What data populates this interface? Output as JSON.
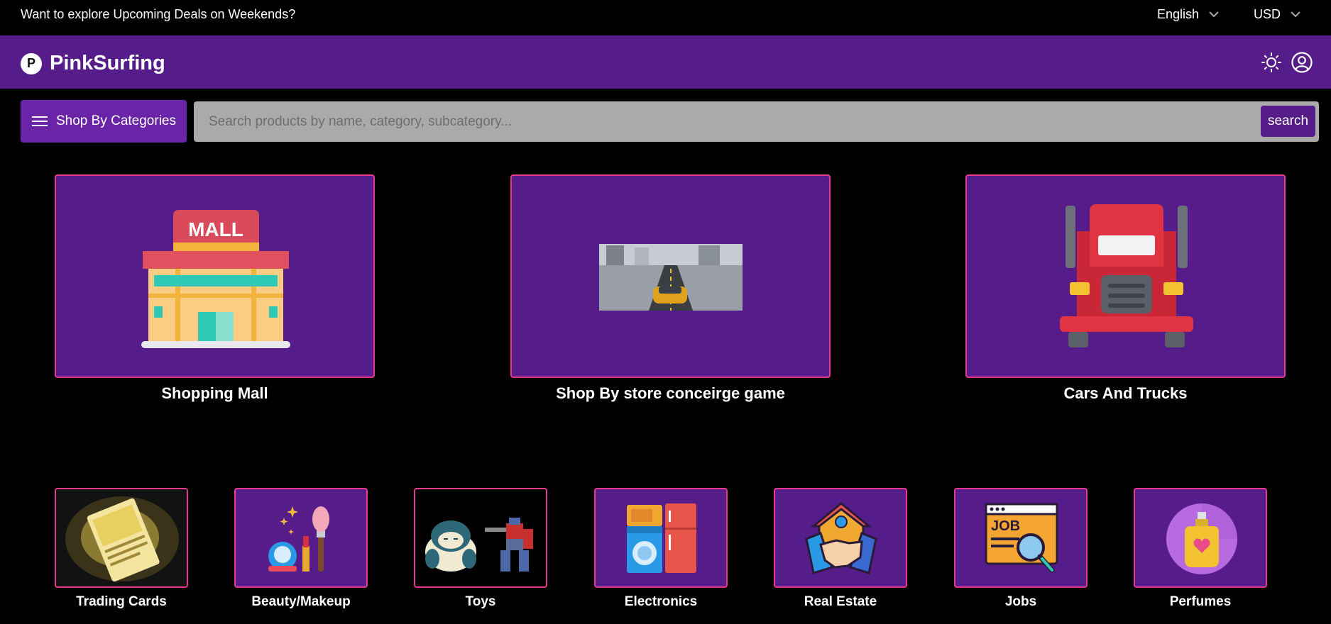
{
  "topbar": {
    "promo": "Want to explore Upcoming Deals on Weekends?",
    "language": "English",
    "currency": "USD"
  },
  "header": {
    "logo_letter": "P",
    "brand": "PinkSurfing",
    "icons": [
      "sun-icon",
      "user-account-icon"
    ]
  },
  "search": {
    "categories_label": "Shop By Categories",
    "placeholder": "Search products by name, category, subcategory...",
    "button_label": "search"
  },
  "featured": [
    {
      "label": "Shopping Mall",
      "icon": "mall-icon"
    },
    {
      "label": "Shop By store conceirge game",
      "icon": "game-screenshot"
    },
    {
      "label": "Cars And Trucks",
      "icon": "truck-icon"
    }
  ],
  "categories": [
    {
      "label": "Trading Cards",
      "icon": "trading-card-image"
    },
    {
      "label": "Beauty/Makeup",
      "icon": "makeup-icon"
    },
    {
      "label": "Toys",
      "icon": "toys-image"
    },
    {
      "label": "Electronics",
      "icon": "appliances-icon"
    },
    {
      "label": "Real Estate",
      "icon": "real-estate-icon"
    },
    {
      "label": "Jobs",
      "icon": "job-search-icon"
    },
    {
      "label": "Perfumes",
      "icon": "perfume-icon"
    }
  ],
  "colors": {
    "header_bg": "#561d8a",
    "card_bg": "#561d8a",
    "card_border": "#e43a8e",
    "page_bg": "#000000"
  }
}
